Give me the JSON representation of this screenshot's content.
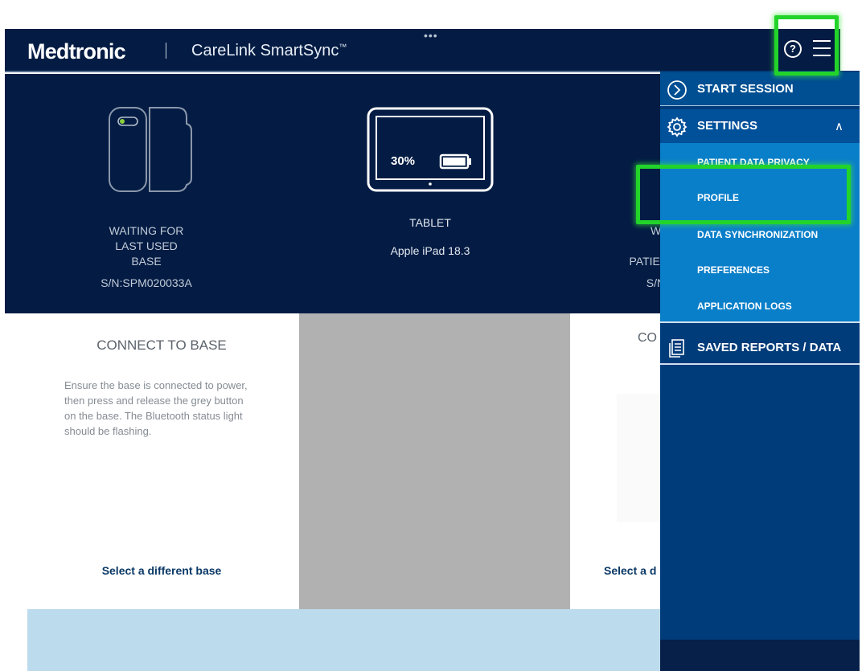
{
  "header": {
    "logo": "Medtronic",
    "app_title": "CareLink SmartSync",
    "trademark": "™",
    "more_dots": "•••",
    "help_glyph": "?"
  },
  "devices": {
    "base": {
      "status_lines": [
        "WAITING FOR",
        "LAST USED",
        "BASE"
      ],
      "serial": "S/N:SPM020033A",
      "icon": "base-device-icon"
    },
    "tablet": {
      "battery_percent": "30%",
      "battery_level": 0.3,
      "name": "TABLET",
      "model": "Apple iPad 18.3",
      "icon": "tablet-icon"
    },
    "patient": {
      "status_lines": [
        "WA",
        "L",
        "PATIEN"
      ],
      "serial": "S/N:"
    }
  },
  "connect_base": {
    "title": "CONNECT TO BASE",
    "instructions": "Ensure the base is connected to power, then press and release the grey button on the base. The Bluetooth status light should be flashing.",
    "link": "Select a different base"
  },
  "right_peek": {
    "title": "CO",
    "link": "Select a d"
  },
  "menu": {
    "start_session": "START SESSION",
    "settings": "SETTINGS",
    "settings_chevron": "∧",
    "settings_items": [
      "PATIENT DATA PRIVACY",
      "PROFILE",
      "DATA SYNCHRONIZATION",
      "PREFERENCES",
      "APPLICATION LOGS"
    ],
    "saved_reports": "SAVED REPORTS / DATA"
  },
  "colors": {
    "header_navy": "#041c44",
    "menu_blue": "#003c7a",
    "submenu_blue": "#0a7fc9",
    "highlight_green": "#22d42a",
    "footer_band": "#bcdbed"
  }
}
